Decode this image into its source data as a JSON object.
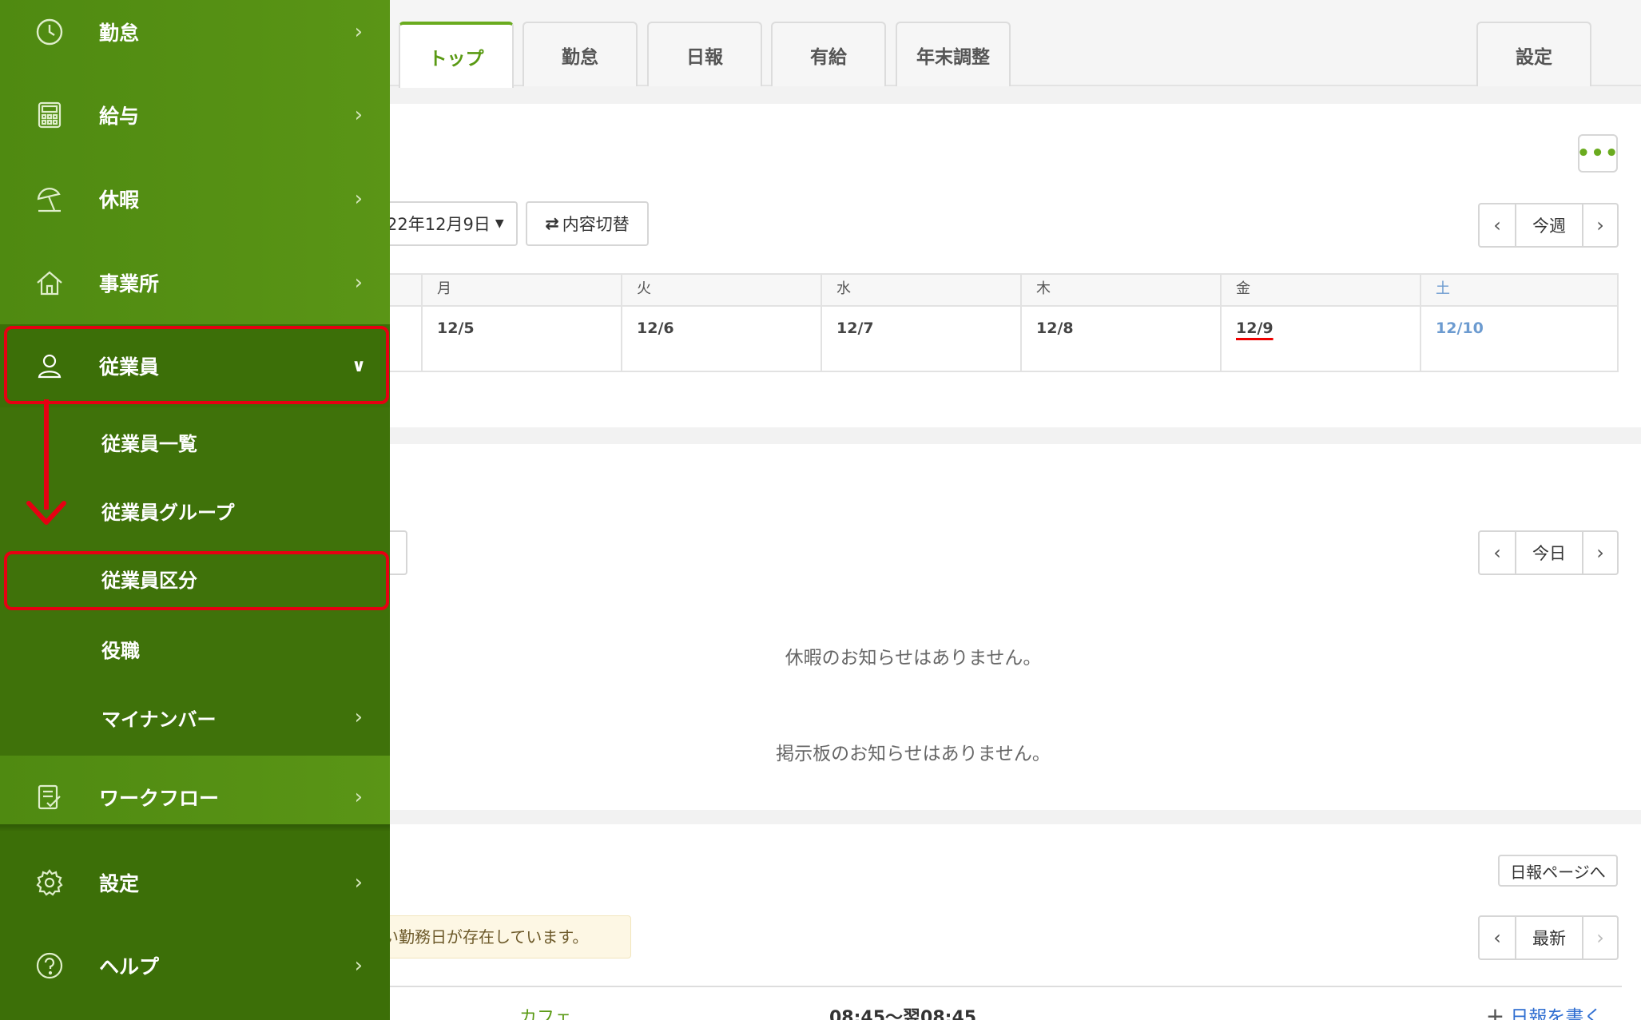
{
  "tabs": [
    {
      "label": "トップ",
      "active": true
    },
    {
      "label": "勤怠",
      "active": false
    },
    {
      "label": "日報",
      "active": false
    },
    {
      "label": "有給",
      "active": false
    },
    {
      "label": "年末調整",
      "active": false
    }
  ],
  "settings_tab": "設定",
  "week_section": {
    "date_selector": "22年12月9日",
    "toggle_button": "内容切替",
    "nav_current": "今週",
    "more_icon": "ellipsis-icon",
    "days": [
      {
        "weekday": "月",
        "date": "12/5"
      },
      {
        "weekday": "火",
        "date": "12/6"
      },
      {
        "weekday": "水",
        "date": "12/7"
      },
      {
        "weekday": "木",
        "date": "12/8"
      },
      {
        "weekday": "金",
        "date": "12/9"
      },
      {
        "weekday": "土",
        "date": "12/10"
      }
    ]
  },
  "notice_section": {
    "nav_current": "今日",
    "no_leave": "休暇のお知らせはありません。",
    "no_board": "掲示板のお知らせはありません。"
  },
  "report_section": {
    "report_page_button": "日報ページへ",
    "warning": "い勤務日が存在しています。",
    "nav_current": "最新",
    "row_place": "カフェ",
    "row_time": "08:45～翌08:45",
    "write_link": "日報を書く"
  },
  "sidebar": {
    "items": [
      {
        "label": "勤怠",
        "icon": "clock-icon"
      },
      {
        "label": "給与",
        "icon": "calculator-icon"
      },
      {
        "label": "休暇",
        "icon": "beach-umbrella-icon"
      },
      {
        "label": "事業所",
        "icon": "home-icon"
      },
      {
        "label": "従業員",
        "icon": "person-icon"
      }
    ],
    "sub_items": [
      {
        "label": "従業員一覧"
      },
      {
        "label": "従業員グループ"
      },
      {
        "label": "従業員区分"
      },
      {
        "label": "役職"
      },
      {
        "label": "マイナンバー"
      }
    ],
    "lower_items": [
      {
        "label": "ワークフロー",
        "icon": "checklist-icon"
      },
      {
        "label": "設定",
        "icon": "gear-icon"
      },
      {
        "label": "ヘルプ",
        "icon": "help-icon"
      }
    ]
  },
  "colors": {
    "brand_green": "#5a9516",
    "highlight_red": "#e60012",
    "saturday_blue": "#6c9bd0"
  }
}
